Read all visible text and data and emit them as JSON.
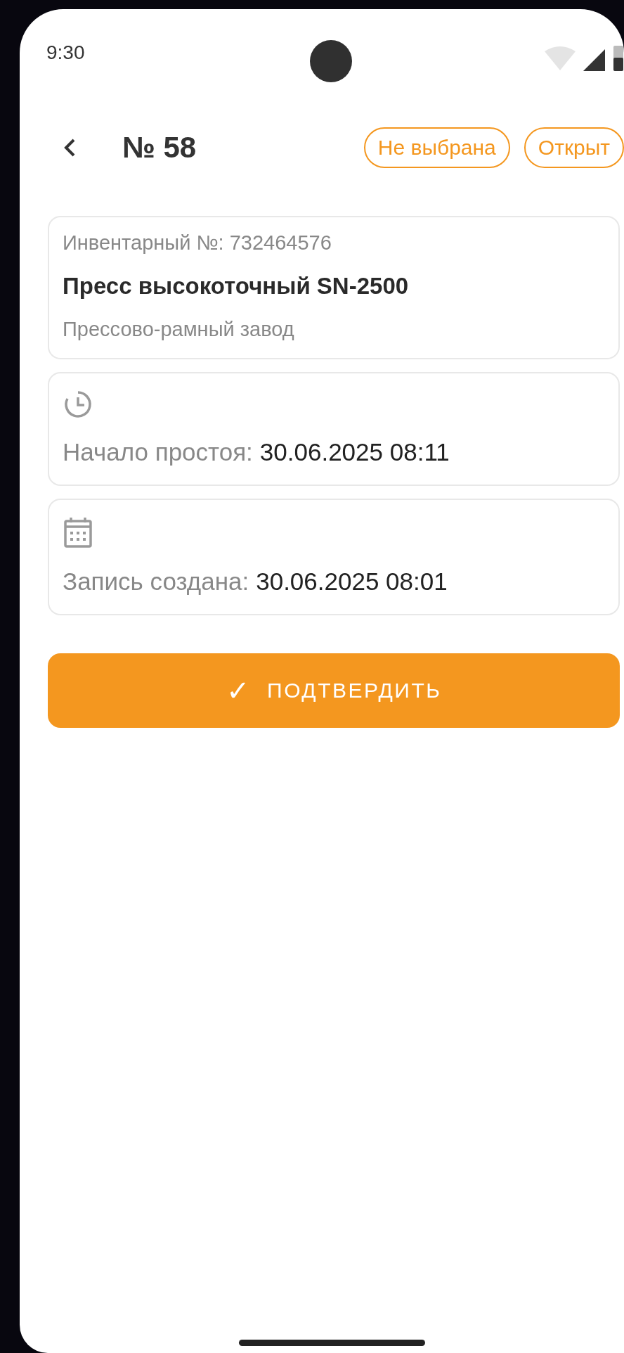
{
  "status_bar": {
    "time": "9:30"
  },
  "header": {
    "title": "№ 58",
    "chips": [
      "Не выбрана",
      "Открыт"
    ]
  },
  "equipment": {
    "inventory": "Инвентарный №: 732464576",
    "name": "Пресс высокоточный SN-2500",
    "plant": "Прессово-рамный завод"
  },
  "info": [
    {
      "kind": "clock",
      "label": "Начало простоя:",
      "value": "30.06.2025 08:11"
    },
    {
      "kind": "calendar",
      "label": "Запись создана:",
      "value": "30.06.2025 08:01"
    }
  ],
  "confirm_button": {
    "icon": "✓",
    "label": "ПОДТВЕРДИТЬ"
  }
}
